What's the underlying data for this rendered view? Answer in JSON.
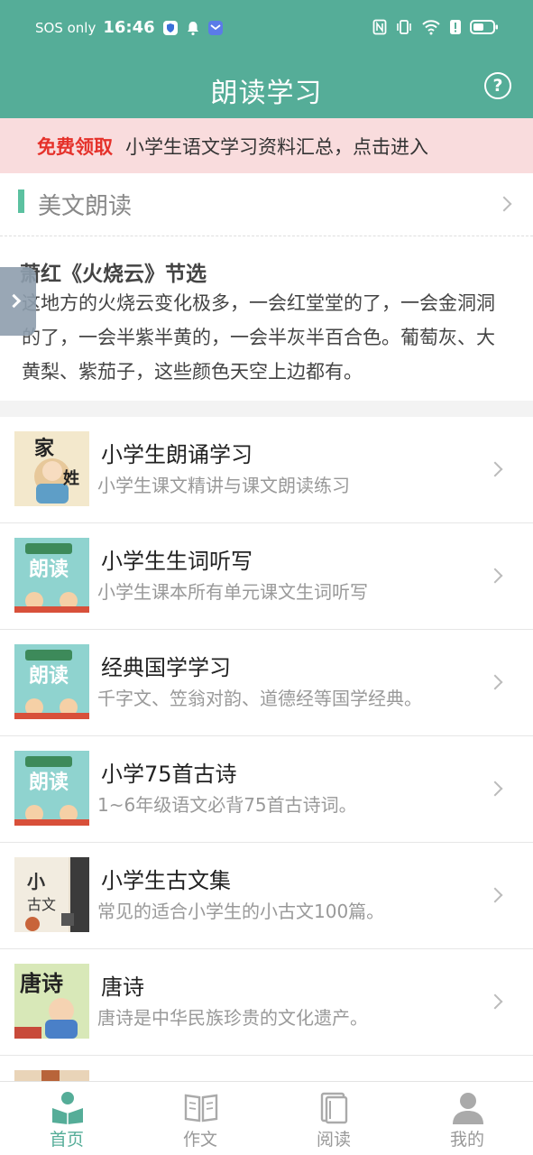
{
  "status": {
    "sos": "SOS only",
    "time": "16:46"
  },
  "header": {
    "title": "朗读学习",
    "help_label": "?"
  },
  "promo": {
    "tag": "免费领取",
    "text": "小学生语文学习资料汇总，点击进入"
  },
  "section": {
    "title": "美文朗读",
    "article_title": "萧红《火烧云》节选",
    "article_body": "这地方的火烧云变化极多，一会红堂堂的了，一会金洞洞的了，一会半紫半黄的，一会半灰半百合色。葡萄灰、大黄梨、紫茄子，这些颜色天空上边都有。"
  },
  "list": {
    "items": [
      {
        "title": "小学生朗诵学习",
        "subtitle": "小学生课文精讲与课文朗读练习",
        "thumb_text": "百家姓",
        "thumb_color": "#f2e6c8"
      },
      {
        "title": "小学生生词听写",
        "subtitle": "小学生课本所有单元课文生词听写",
        "thumb_text": "朗读",
        "thumb_color": "#8fd3cf"
      },
      {
        "title": "经典国学学习",
        "subtitle": "千字文、笠翁对韵、道德经等国学经典。",
        "thumb_text": "朗读",
        "thumb_color": "#8fd3cf"
      },
      {
        "title": "小学75首古诗",
        "subtitle": "1~6年级语文必背75首古诗词。",
        "thumb_text": "朗读",
        "thumb_color": "#8fd3cf"
      },
      {
        "title": "小学生古文集",
        "subtitle": "常见的适合小学生的小古文100篇。",
        "thumb_text": "小古文",
        "thumb_color": "#e8dfcf"
      },
      {
        "title": "唐诗",
        "subtitle": "唐诗是中华民族珍贵的文化遗产。",
        "thumb_text": "唐诗",
        "thumb_color": "#d8e8b8"
      }
    ]
  },
  "tabs": [
    {
      "label": "首页",
      "active": true
    },
    {
      "label": "作文",
      "active": false
    },
    {
      "label": "阅读",
      "active": false
    },
    {
      "label": "我的",
      "active": false
    }
  ],
  "colors": {
    "primary": "#55ad98",
    "promo_bg": "#f9dcdd",
    "promo_tag": "#e5312a"
  }
}
